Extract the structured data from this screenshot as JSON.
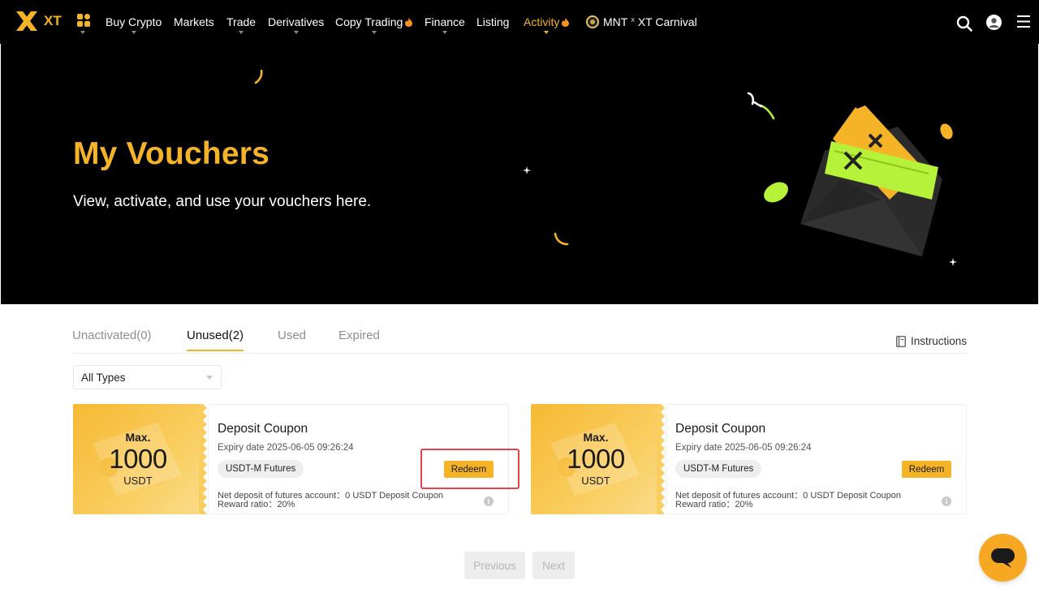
{
  "nav": {
    "brand": "XT",
    "items": [
      {
        "label": "Buy Crypto",
        "dropdown": true,
        "hot": false
      },
      {
        "label": "Markets",
        "dropdown": false,
        "hot": false
      },
      {
        "label": "Trade",
        "dropdown": true,
        "hot": false
      },
      {
        "label": "Derivatives",
        "dropdown": true,
        "hot": false
      },
      {
        "label": "Copy Trading",
        "dropdown": true,
        "hot": true
      },
      {
        "label": "Finance",
        "dropdown": true,
        "hot": false
      },
      {
        "label": "Listing",
        "dropdown": false,
        "hot": false
      },
      {
        "label": "Activity",
        "dropdown": true,
        "hot": true,
        "active": true
      }
    ],
    "promo": {
      "left": "MNT",
      "x": "x",
      "right": "XT Carnival"
    },
    "icons": [
      "apps-icon",
      "search-icon",
      "user-icon",
      "menu-icon"
    ]
  },
  "hero": {
    "title": "My Vouchers",
    "subtitle": "View, activate, and use your vouchers here."
  },
  "tabs": [
    {
      "label": "Unactivated(0)",
      "active": false
    },
    {
      "label": "Unused(2)",
      "active": true
    },
    {
      "label": "Used",
      "active": false
    },
    {
      "label": "Expired",
      "active": false
    }
  ],
  "instructions_label": "Instructions",
  "filter": {
    "selected": "All Types"
  },
  "vouchers": [
    {
      "max_label": "Max.",
      "amount": "1000",
      "unit": "USDT",
      "title": "Deposit Coupon",
      "expiry": "Expiry date 2025-06-05 09:26:24",
      "tag": "USDT-M Futures",
      "action": "Redeem",
      "info_line1": "Net deposit of futures account：0 USDT  Deposit Coupon",
      "info_line2": "Reward ratio：20%"
    },
    {
      "max_label": "Max.",
      "amount": "1000",
      "unit": "USDT",
      "title": "Deposit Coupon",
      "expiry": "Expiry date 2025-06-05 09:26:24",
      "tag": "USDT-M Futures",
      "action": "Redeem",
      "info_line1": "Net deposit of futures account：0 USDT  Deposit Coupon",
      "info_line2": "Reward ratio：20%"
    }
  ],
  "pagination": {
    "previous": "Previous",
    "next": "Next"
  },
  "colors": {
    "accent": "#f5b327",
    "nav_bg": "#000000",
    "highlight": "#e8424a",
    "lime": "#b7f23a"
  }
}
